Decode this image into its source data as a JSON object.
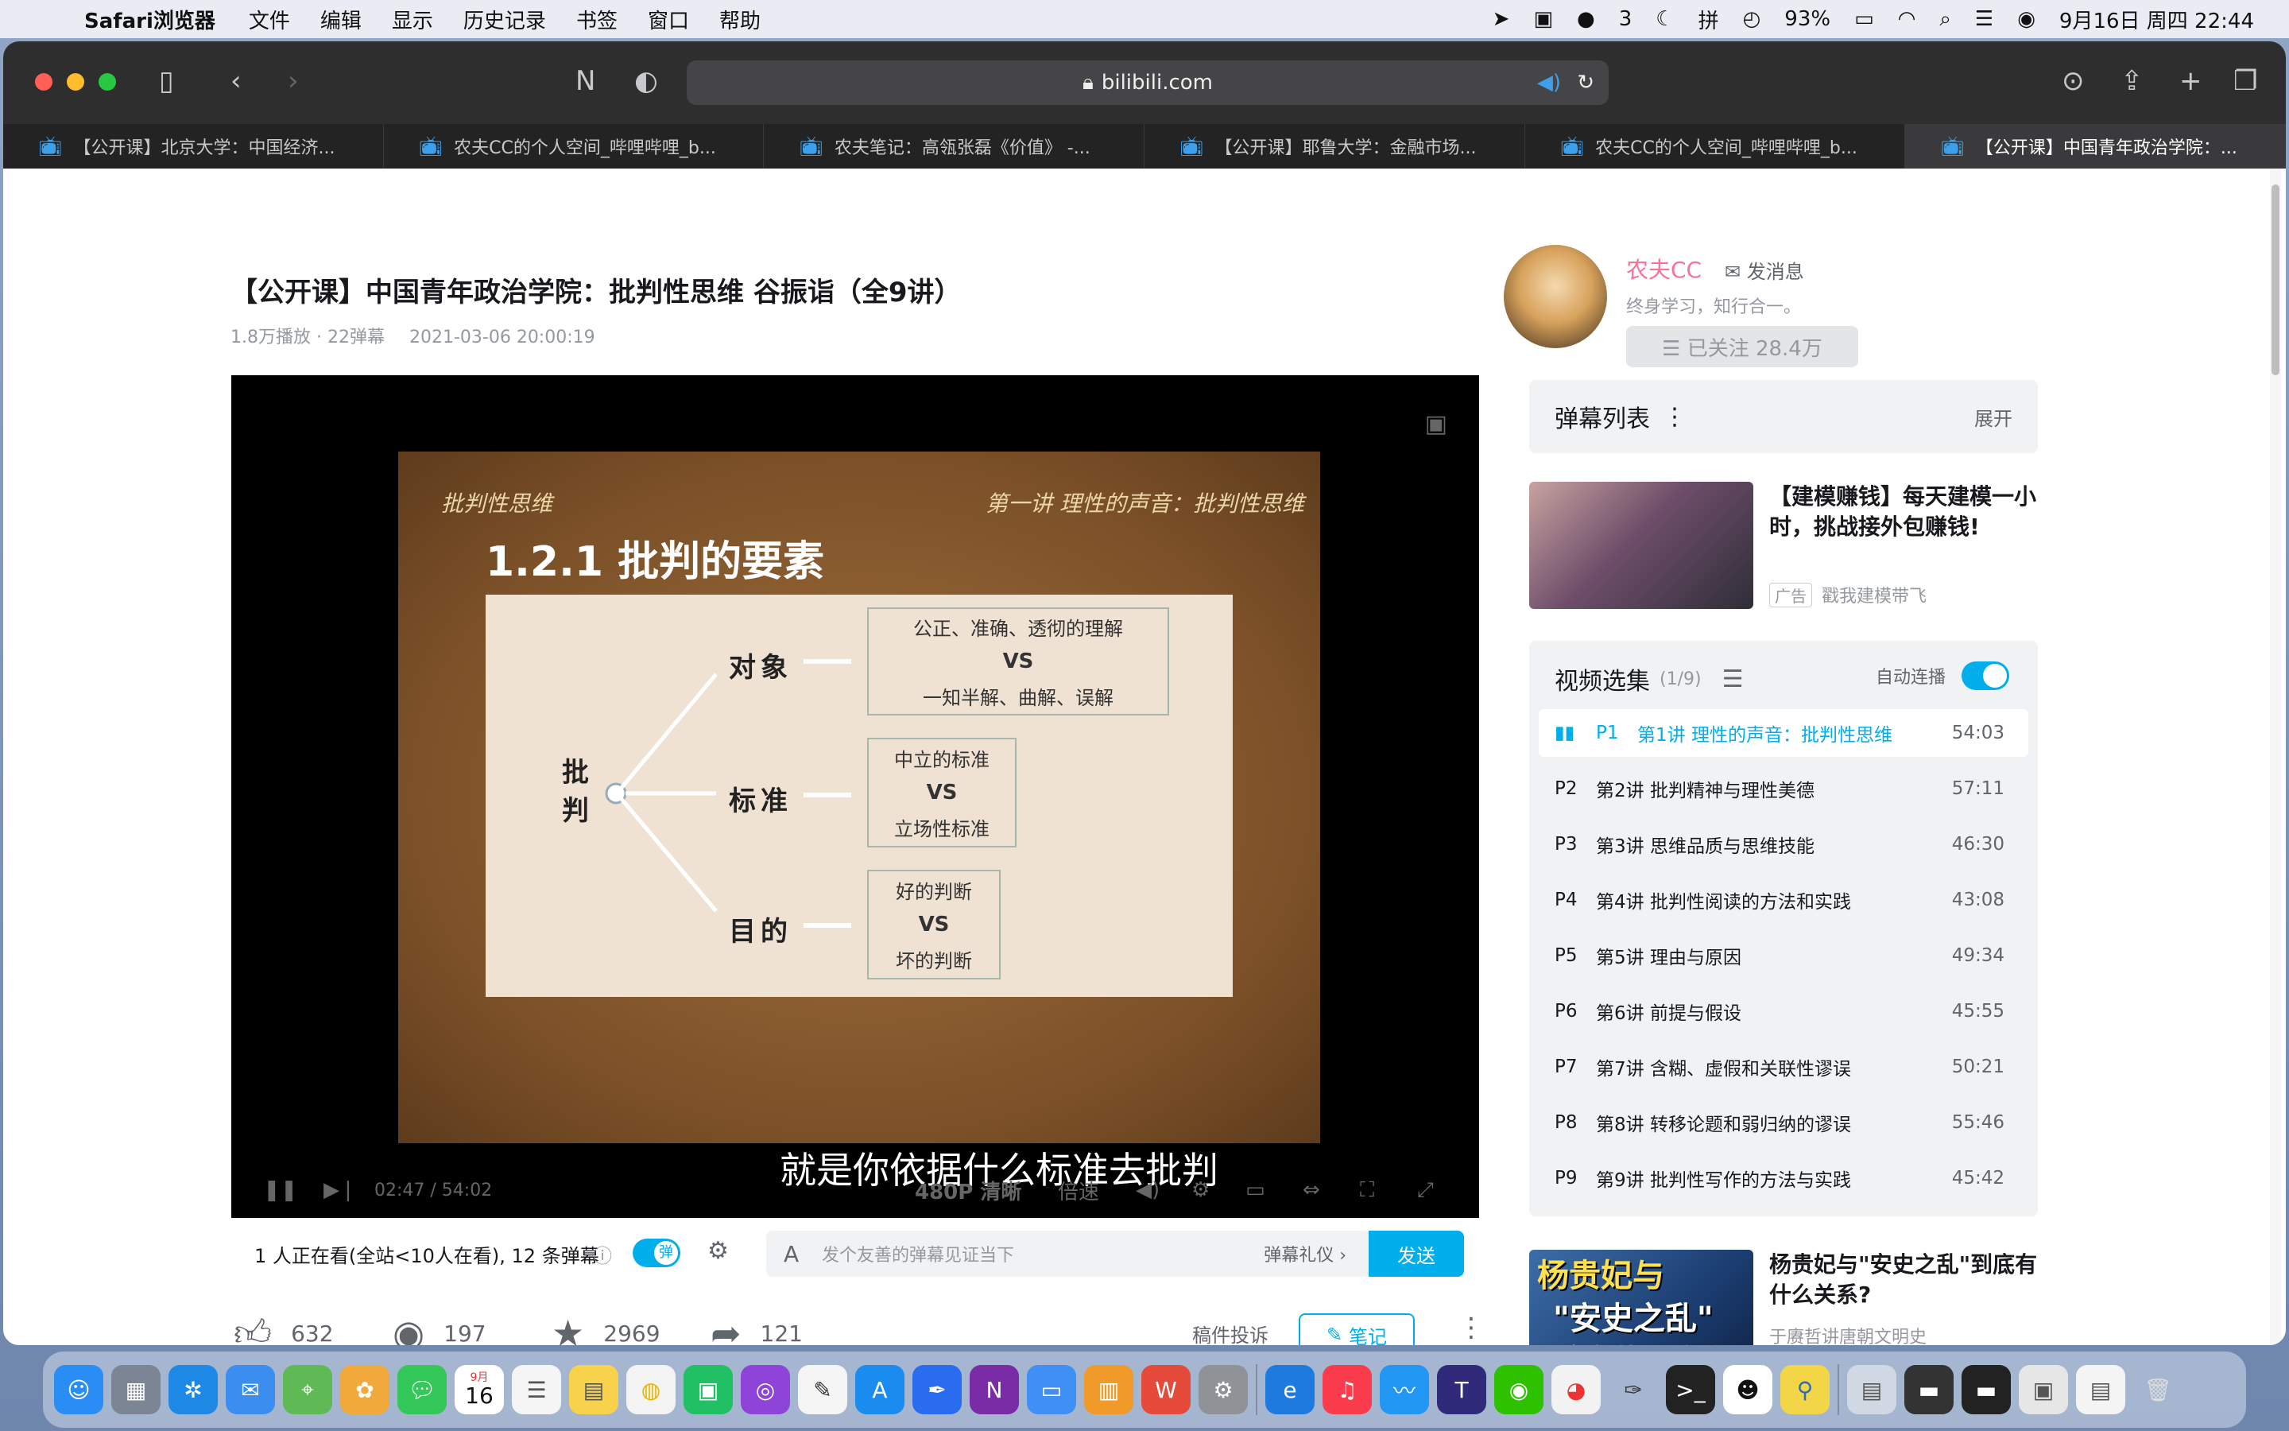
{
  "menubar": {
    "app_name": "Safari浏览器",
    "items": [
      "文件",
      "编辑",
      "显示",
      "历史记录",
      "书签",
      "窗口",
      "帮助"
    ],
    "status": {
      "wechat_count": "3",
      "battery": "93%",
      "datetime": "9月16日 周四  22:44"
    }
  },
  "browser": {
    "url": "bilibili.com",
    "tabs": [
      {
        "title": "【公开课】北京大学：中国经济..."
      },
      {
        "title": "农夫CC的个人空间_哔哩哔哩_b..."
      },
      {
        "title": "农夫笔记：高瓴张磊《价值》 -..."
      },
      {
        "title": "【公开课】耶鲁大学：金融市场..."
      },
      {
        "title": "农夫CC的个人空间_哔哩哔哩_b..."
      },
      {
        "title": "【公开课】中国青年政治学院：..."
      }
    ]
  },
  "video": {
    "title": "【公开课】中国青年政治学院：批判性思维 谷振诣（全9讲）",
    "views": "1.8万播放 · 22弹幕",
    "date": "2021-03-06 20:00:19",
    "slide": {
      "course": "批判性思维",
      "lecture": "第一讲  理性的声音：批判性思维",
      "heading": "1.2.1 批判的要素",
      "center_label": "批\n判",
      "branches": [
        {
          "label": "对象",
          "items": [
            "公正、准确、透彻的理解",
            "VS",
            "一知半解、曲解、误解"
          ]
        },
        {
          "label": "标准",
          "items": [
            "中立的标准",
            "VS",
            "立场性标准"
          ]
        },
        {
          "label": "目的",
          "items": [
            "好的判断",
            "VS",
            "坏的判断"
          ]
        }
      ],
      "subtitle": "就是你依据什么标准去批判"
    },
    "controls": {
      "time": "02:47 / 54:02",
      "quality": "480P 清晰",
      "speed": "倍速"
    }
  },
  "danmaku_bar": {
    "online": "1 人正在看(全站<10人在看), 12 条弹幕",
    "toggle_label": "弹",
    "input_placeholder": "发个友善的弹幕见证当下",
    "etiquette": "弹幕礼仪 ›",
    "send": "发送"
  },
  "actions": {
    "likes": "632",
    "coins": "197",
    "favorites": "2969",
    "shares": "121",
    "report": "稿件投诉",
    "note": "笔记"
  },
  "uploader": {
    "name": "农夫CC",
    "message": "发消息",
    "signature": "终身学习，知行合一。",
    "follow_label": "☰  已关注 28.4万"
  },
  "danmaku_list": {
    "title": "弹幕列表",
    "expand": "展开"
  },
  "ad": {
    "title": "【建模赚钱】每天建模一小时，挑战接外包赚钱!",
    "tag": "广告",
    "source": "戳我建模带飞"
  },
  "playlist": {
    "title": "视频选集",
    "count": "(1/9)",
    "autoplay": "自动连播",
    "episodes": [
      {
        "p": "P1",
        "title": "第1讲 理性的声音：批判性思维",
        "duration": "54:03"
      },
      {
        "p": "P2",
        "title": "第2讲 批判精神与理性美德",
        "duration": "57:11"
      },
      {
        "p": "P3",
        "title": "第3讲 思维品质与思维技能",
        "duration": "46:30"
      },
      {
        "p": "P4",
        "title": "第4讲 批判性阅读的方法和实践",
        "duration": "43:08"
      },
      {
        "p": "P5",
        "title": "第5讲 理由与原因",
        "duration": "49:34"
      },
      {
        "p": "P6",
        "title": "第6讲 前提与假设",
        "duration": "45:55"
      },
      {
        "p": "P7",
        "title": "第7讲 含糊、虚假和关联性谬误",
        "duration": "50:21"
      },
      {
        "p": "P8",
        "title": "第8讲 转移论题和弱归纳的谬误",
        "duration": "55:46"
      },
      {
        "p": "P9",
        "title": "第9讲 批判性写作的方法与实践",
        "duration": "45:42"
      }
    ]
  },
  "recommend": {
    "thumb_text": [
      "杨贵妃与",
      "\"安史之乱\"",
      "到底有什么关系?"
    ],
    "title": "杨贵妃与\"安史之乱\"到底有什么关系?",
    "author": "于赓哲讲唐朝文明史"
  },
  "dock": {
    "calendar_month": "9月",
    "calendar_day": "16"
  }
}
